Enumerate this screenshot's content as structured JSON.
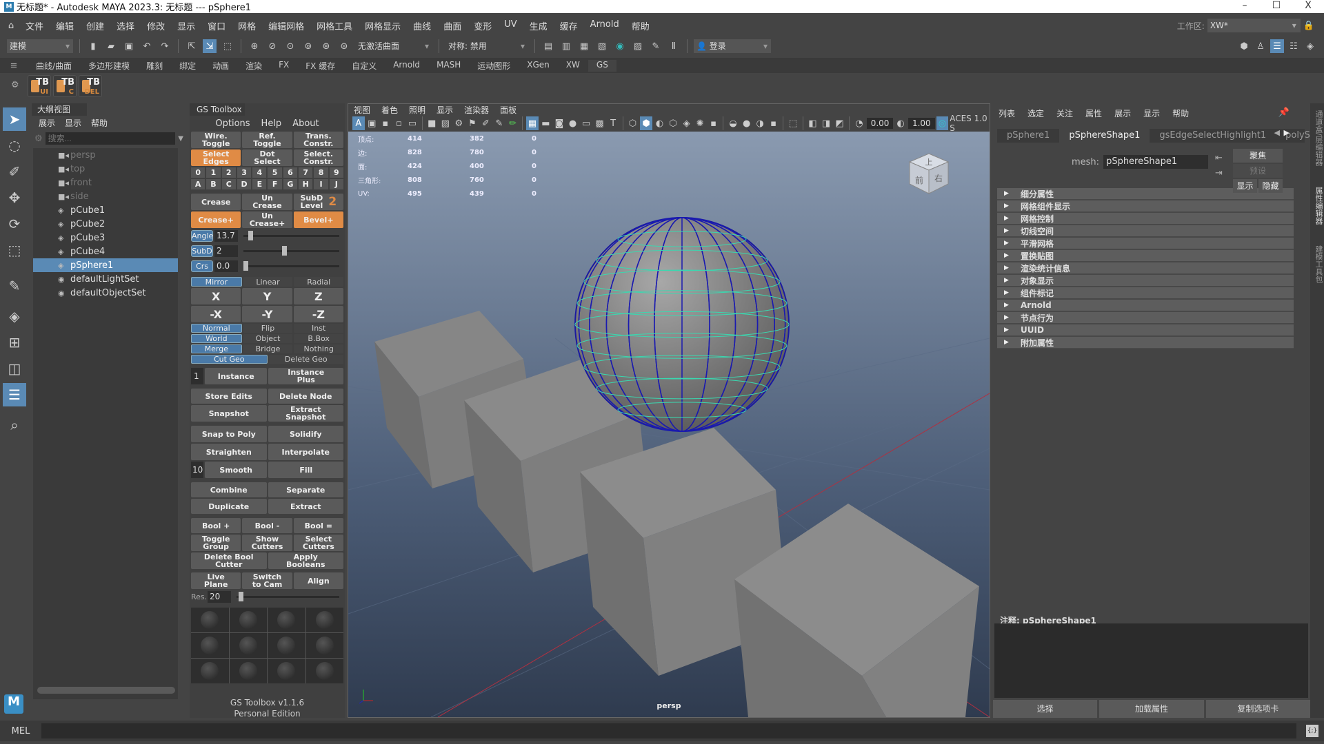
{
  "window": {
    "title": "无标题* - Autodesk MAYA 2023.3: 无标题   ---   pSphere1",
    "minimize": "–",
    "maximize": "☐",
    "close": "X"
  },
  "menubar": {
    "items": [
      "文件",
      "编辑",
      "创建",
      "选择",
      "修改",
      "显示",
      "窗口",
      "网格",
      "编辑网格",
      "网格工具",
      "网格显示",
      "曲线",
      "曲面",
      "变形",
      "UV",
      "生成",
      "缓存",
      "Arnold",
      "帮助"
    ],
    "workspace_label": "工作区:",
    "workspace_value": "XW*"
  },
  "statusline": {
    "mode": "建模",
    "live_surface": "无激活曲面",
    "symmetry": "对称: 禁用",
    "login": "登录"
  },
  "shelf": {
    "tabs": [
      "曲线/曲面",
      "多边形建模",
      "雕刻",
      "绑定",
      "动画",
      "渲染",
      "FX",
      "FX 缓存",
      "自定义",
      "Arnold",
      "MASH",
      "运动图形",
      "XGen",
      "XW",
      "GS"
    ],
    "active_tab": "GS",
    "buttons": [
      {
        "label": "TB",
        "sub": "UI"
      },
      {
        "label": "TB",
        "sub": "C"
      },
      {
        "label": "TB",
        "sub": "DEL"
      }
    ]
  },
  "outliner": {
    "title": "大纲视图",
    "menu": [
      "展示",
      "显示",
      "帮助"
    ],
    "search_placeholder": "搜索...",
    "items": [
      {
        "name": "persp",
        "type": "camera",
        "dim": true
      },
      {
        "name": "top",
        "type": "camera",
        "dim": true
      },
      {
        "name": "front",
        "type": "camera",
        "dim": true
      },
      {
        "name": "side",
        "type": "camera",
        "dim": true
      },
      {
        "name": "pCube1",
        "type": "mesh"
      },
      {
        "name": "pCube2",
        "type": "mesh"
      },
      {
        "name": "pCube3",
        "type": "mesh"
      },
      {
        "name": "pCube4",
        "type": "mesh"
      },
      {
        "name": "pSphere1",
        "type": "mesh",
        "selected": true
      },
      {
        "name": "defaultLightSet",
        "type": "set"
      },
      {
        "name": "defaultObjectSet",
        "type": "set"
      }
    ]
  },
  "gs_toolbox": {
    "tab": "GS Toolbox",
    "menu": [
      "Options",
      "Help",
      "About"
    ],
    "row1": [
      "Wire.\nToggle",
      "Ref.\nToggle",
      "Trans.\nConstr."
    ],
    "row2": [
      "Select\nEdges",
      "Dot\nSelect",
      "Select.\nConstr."
    ],
    "digits": [
      "0",
      "1",
      "2",
      "3",
      "4",
      "5",
      "6",
      "7",
      "8",
      "9"
    ],
    "letters": [
      "A",
      "B",
      "C",
      "D",
      "E",
      "F",
      "G",
      "H",
      "I",
      "J"
    ],
    "row3": [
      "Crease",
      "Un\nCrease",
      "SubD\nLevel"
    ],
    "subd_level": "2",
    "row4": [
      "Crease+",
      "Un\nCrease+",
      "Bevel+"
    ],
    "sliders": [
      {
        "label": "Angle",
        "value": "13.7",
        "position": 0.05
      },
      {
        "label": "SubD",
        "value": "2",
        "position": 0.4
      },
      {
        "label": "Crs",
        "value": "0.0",
        "position": 0.0
      }
    ],
    "mirror_modes": [
      "Mirror",
      "Linear",
      "Radial"
    ],
    "axes": [
      "X",
      "Y",
      "Z"
    ],
    "neg_axes": [
      "-X",
      "-Y",
      "-Z"
    ],
    "row_normal": [
      "Normal",
      "Flip",
      "Inst"
    ],
    "row_world": [
      "World",
      "Object",
      "B.Box"
    ],
    "row_merge": [
      "Merge",
      "Bridge",
      "Nothing"
    ],
    "row_cut": [
      "Cut Geo",
      "Delete Geo"
    ],
    "instance_count": "1",
    "instance": "Instance",
    "instance_plus": "Instance\nPlus",
    "store_edits": "Store Edits",
    "delete_node": "Delete Node",
    "snapshot": "Snapshot",
    "extract_snapshot": "Extract\nSnapshot",
    "snap_to_poly": "Snap to Poly",
    "solidify": "Solidify",
    "straighten": "Straighten",
    "interpolate": "Interpolate",
    "smooth_count": "10",
    "smooth": "Smooth",
    "fill": "Fill",
    "combine": "Combine",
    "separate": "Separate",
    "duplicate": "Duplicate",
    "extract": "Extract",
    "bools": [
      "Bool +",
      "Bool -",
      "Bool ="
    ],
    "cutters": [
      "Toggle\nGroup",
      "Show\nCutters",
      "Select\nCutters"
    ],
    "delete_bool": "Delete Bool\nCutter",
    "apply_booleans": "Apply\nBooleans",
    "live": [
      "Live\nPlane",
      "Switch\nto Cam",
      "Align"
    ],
    "res_label": "Res.",
    "res_value": "20",
    "res_position": 0.02,
    "footer_1": "GS Toolbox v1.1.6",
    "footer_2": "Personal Edition"
  },
  "viewport": {
    "menu": [
      "视图",
      "着色",
      "照明",
      "显示",
      "渲染器",
      "面板"
    ],
    "exposure": "0.00",
    "gamma": "1.00",
    "color_space": "ACES 1.0 S",
    "hud": [
      {
        "label": "顶点:",
        "a": "414",
        "b": "382",
        "c": "0"
      },
      {
        "label": "边:",
        "a": "828",
        "b": "780",
        "c": "0"
      },
      {
        "label": "面:",
        "a": "424",
        "b": "400",
        "c": "0"
      },
      {
        "label": "三角形:",
        "a": "808",
        "b": "760",
        "c": "0"
      },
      {
        "label": "UV:",
        "a": "495",
        "b": "439",
        "c": "0"
      }
    ],
    "camera": "persp",
    "cube_faces": {
      "top": "上",
      "front": "前",
      "right": "右"
    }
  },
  "attribute_editor": {
    "menu": [
      "列表",
      "选定",
      "关注",
      "属性",
      "展示",
      "显示",
      "帮助"
    ],
    "tabs": [
      "pSphere1",
      "pSphereShape1",
      "gsEdgeSelectHighlight1",
      "polySpher"
    ],
    "active_tab": "pSphereShape1",
    "mesh_label": "mesh:",
    "mesh_value": "pSphereShape1",
    "focus": "聚焦",
    "presets": "预设",
    "show": "显示",
    "hide": "隐藏",
    "sections": [
      "细分属性",
      "网格组件显示",
      "网格控制",
      "切线空间",
      "平滑网格",
      "置换贴图",
      "渲染统计信息",
      "对象显示",
      "组件标记",
      "Arnold",
      "节点行为",
      "UUID",
      "附加属性"
    ],
    "notes_label": "注释:  pSphereShape1",
    "buttons": [
      "选择",
      "加载属性",
      "复制选项卡"
    ]
  },
  "side_tabs": [
    "通道盒/层编辑器",
    "属性编辑器",
    "建模工具包"
  ],
  "command_line": {
    "label": "MEL"
  }
}
